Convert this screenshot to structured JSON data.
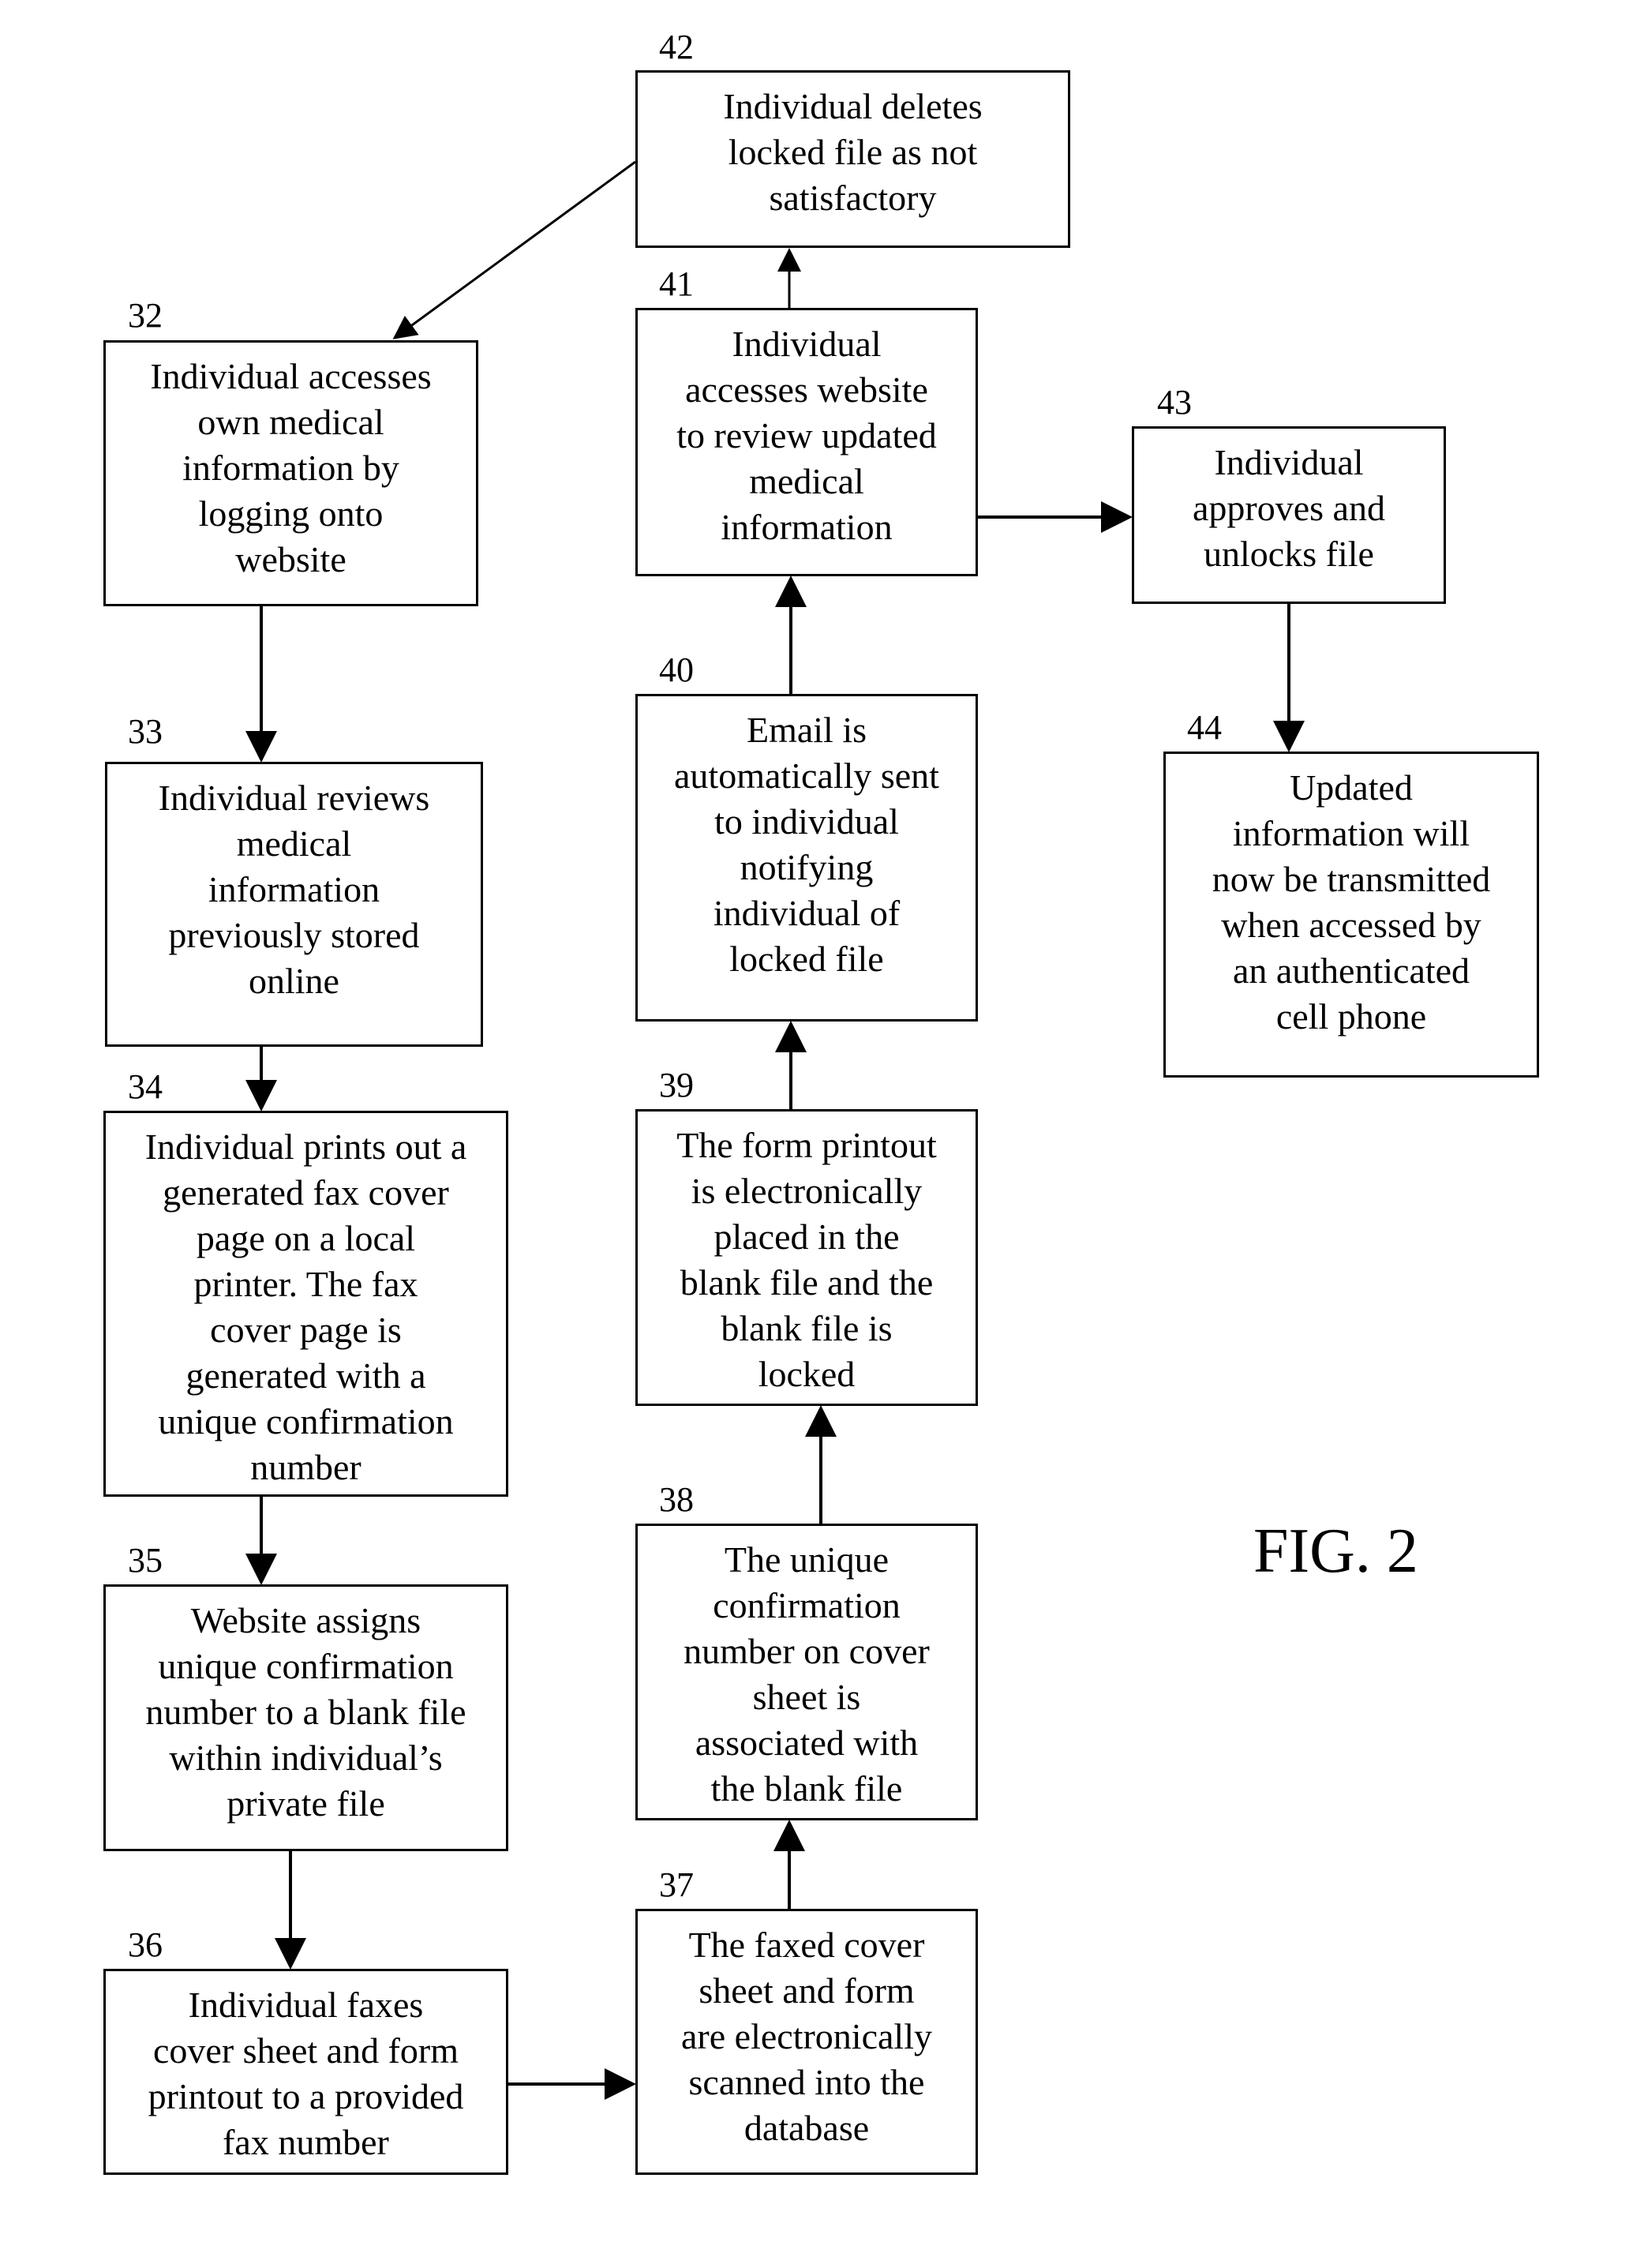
{
  "figure_label": "FIG. 2",
  "steps": {
    "s32": {
      "ref": "32",
      "text": "Individual accesses\nown medical\ninformation by\nlogging onto\nwebsite"
    },
    "s33": {
      "ref": "33",
      "text": "Individual reviews\nmedical\ninformation\npreviously stored\nonline"
    },
    "s34": {
      "ref": "34",
      "text": "Individual prints out a\ngenerated fax cover\npage on a local\nprinter.  The fax\ncover page is\ngenerated with a\nunique confirmation\nnumber"
    },
    "s35": {
      "ref": "35",
      "text": "Website assigns\nunique confirmation\nnumber to a blank file\nwithin individual’s\nprivate file"
    },
    "s36": {
      "ref": "36",
      "text": "Individual faxes\ncover sheet and form\nprintout to a provided\nfax number"
    },
    "s37": {
      "ref": "37",
      "text": "The faxed cover\nsheet and form\nare electronically\nscanned into the\ndatabase"
    },
    "s38": {
      "ref": "38",
      "text": "The unique\nconfirmation\nnumber on cover\nsheet is\nassociated with\nthe blank file"
    },
    "s39": {
      "ref": "39",
      "text": "The form printout\nis electronically\nplaced in the\nblank file and the\nblank file is\nlocked"
    },
    "s40": {
      "ref": "40",
      "text": "Email is\nautomatically sent\nto individual\nnotifying\nindividual of\nlocked file"
    },
    "s41": {
      "ref": "41",
      "text": "Individual\naccesses website\nto review updated\nmedical\ninformation"
    },
    "s42": {
      "ref": "42",
      "text": "Individual deletes\nlocked file as not\nsatisfactory"
    },
    "s43": {
      "ref": "43",
      "text": "Individual\napproves and\nunlocks file"
    },
    "s44": {
      "ref": "44",
      "text": "Updated\ninformation will\nnow be transmitted\nwhen accessed by\nan authenticated\ncell phone"
    }
  },
  "connections": [
    {
      "from": "42",
      "to": "32"
    },
    {
      "from": "32",
      "to": "33"
    },
    {
      "from": "33",
      "to": "34"
    },
    {
      "from": "34",
      "to": "35"
    },
    {
      "from": "35",
      "to": "36"
    },
    {
      "from": "36",
      "to": "37"
    },
    {
      "from": "37",
      "to": "38"
    },
    {
      "from": "38",
      "to": "39"
    },
    {
      "from": "39",
      "to": "40"
    },
    {
      "from": "40",
      "to": "41"
    },
    {
      "from": "41",
      "to": "42"
    },
    {
      "from": "41",
      "to": "43"
    },
    {
      "from": "43",
      "to": "44"
    }
  ]
}
